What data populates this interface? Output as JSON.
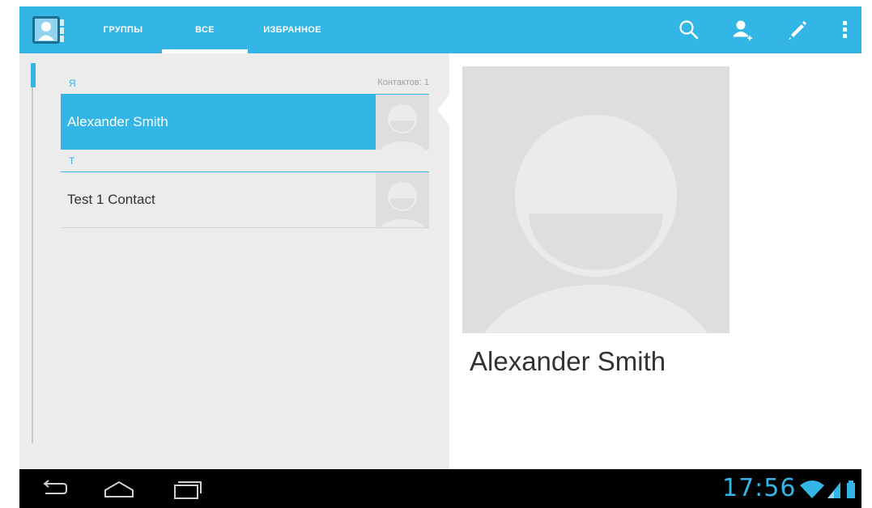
{
  "tabs": [
    {
      "label": "ГРУППЫ",
      "active": false
    },
    {
      "label": "ВСЕ",
      "active": true
    },
    {
      "label": "ИЗБРАННОЕ",
      "active": false
    }
  ],
  "action_icons": [
    "search-icon",
    "add-contact-icon",
    "edit-icon",
    "overflow-menu-icon"
  ],
  "contact_list": {
    "sections": [
      {
        "letter": "Я",
        "count_label": "Контактов: 1",
        "contacts": [
          {
            "name": "Alexander Smith",
            "selected": true
          }
        ]
      },
      {
        "letter": "T",
        "contacts": [
          {
            "name": "Test 1 Contact",
            "selected": false
          }
        ]
      }
    ]
  },
  "detail": {
    "name": "Alexander Smith"
  },
  "system_bar": {
    "time": "17:56",
    "icons": [
      "back-icon",
      "home-icon",
      "recent-apps-icon",
      "wifi-icon",
      "signal-icon",
      "battery-icon"
    ]
  },
  "colors": {
    "accent": "#33b5e5",
    "list_bg": "#ececec",
    "photo_bg": "#dedede",
    "system_bar": "#000000"
  }
}
